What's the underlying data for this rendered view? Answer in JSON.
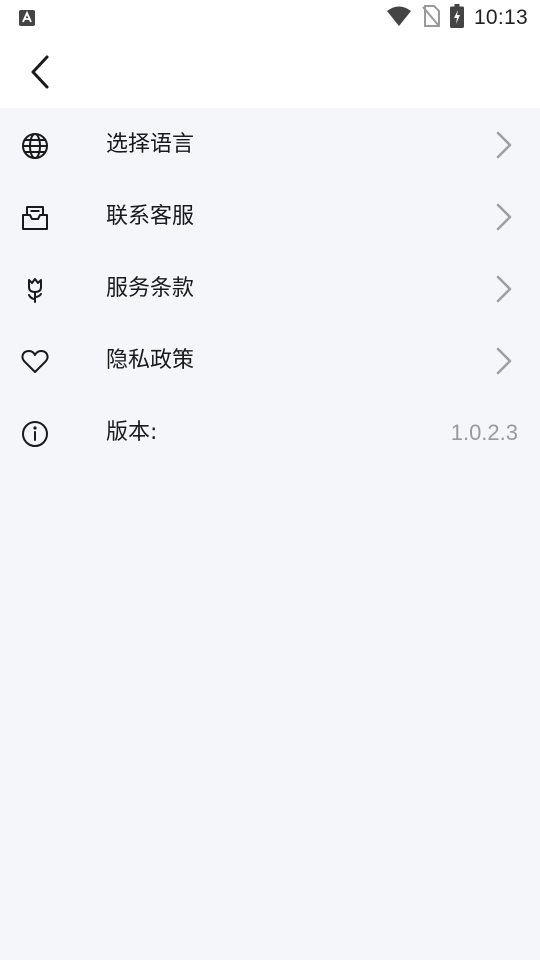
{
  "status_bar": {
    "time": "10:13",
    "left_icon": "a-notification-icon",
    "icons": [
      "wifi-icon",
      "no-sim-icon",
      "battery-charging-icon"
    ]
  },
  "header": {
    "back_icon": "chevron-left-icon"
  },
  "menu": {
    "items": [
      {
        "icon": "globe-icon",
        "label": "选择语言",
        "has_arrow": true
      },
      {
        "icon": "inbox-icon",
        "label": "联系客服",
        "has_arrow": true
      },
      {
        "icon": "tulip-icon",
        "label": "服务条款",
        "has_arrow": true
      },
      {
        "icon": "heart-icon",
        "label": "隐私政策",
        "has_arrow": true
      },
      {
        "icon": "info-icon",
        "label": "版本:",
        "value": "1.0.2.3"
      }
    ]
  },
  "colors": {
    "page_background": "#f5f6fa",
    "header_background": "#ffffff",
    "text": "#1a1a1a",
    "chevron": "#9e9e9e",
    "version_value": "#9a9a9a"
  }
}
